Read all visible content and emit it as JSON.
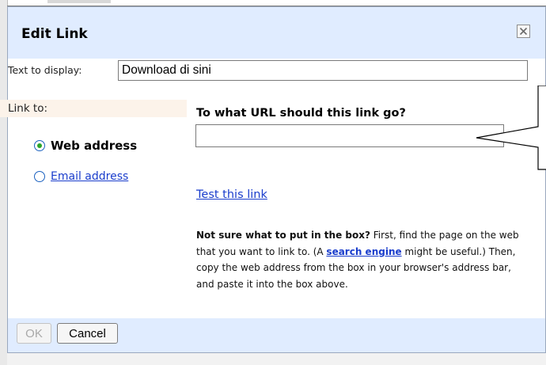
{
  "dialog": {
    "title": "Edit Link",
    "close_icon": "close-x-icon"
  },
  "text_to_display": {
    "label": "Text to display:",
    "value": "Download di sini"
  },
  "link_to": {
    "label": "Link to:",
    "options": [
      {
        "label": "Web address",
        "selected": true
      },
      {
        "label": "Email address",
        "selected": false
      }
    ]
  },
  "url": {
    "heading": "To what URL should this link go?",
    "value": "",
    "test_link": "Test this link"
  },
  "help": {
    "bold_intro": "Not sure what to put in the box?",
    "text_before_link": " First, find the page on the web that you want to link to. (A ",
    "link_text": "search engine",
    "text_after_link": " might be useful.) Then, copy the web address from the box in your browser's address bar, and paste it into the box above."
  },
  "buttons": {
    "ok": "OK",
    "cancel": "Cancel"
  },
  "colors": {
    "titlebar_bg": "#e0ecff",
    "link": "#1a3dcc",
    "radio_dot": "#2aa52a",
    "linkto_bg": "#fcf3ea"
  }
}
